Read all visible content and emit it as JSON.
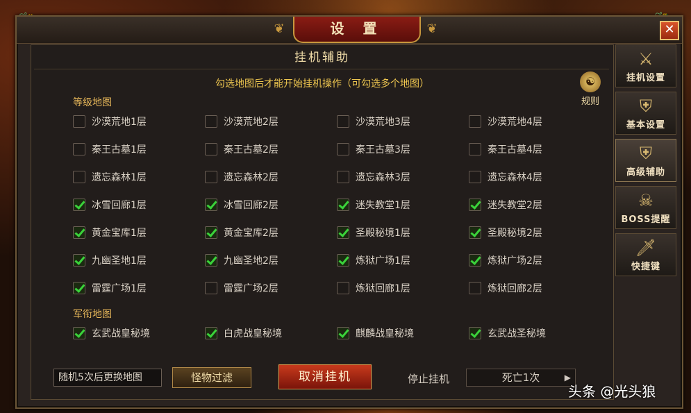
{
  "window": {
    "title": "设 置",
    "close_icon": "✕"
  },
  "panel": {
    "subtitle": "挂机辅助",
    "hint": "勾选地图后才能开始挂机操作（可勾选多个地图）",
    "rules_label": "规则"
  },
  "level_maps": {
    "label": "等级地图",
    "rows": [
      [
        {
          "label": "沙漠荒地1层",
          "checked": false
        },
        {
          "label": "沙漠荒地2层",
          "checked": false
        },
        {
          "label": "沙漠荒地3层",
          "checked": false
        },
        {
          "label": "沙漠荒地4层",
          "checked": false
        }
      ],
      [
        {
          "label": "秦王古墓1层",
          "checked": false
        },
        {
          "label": "秦王古墓2层",
          "checked": false
        },
        {
          "label": "秦王古墓3层",
          "checked": false
        },
        {
          "label": "秦王古墓4层",
          "checked": false
        }
      ],
      [
        {
          "label": "遗忘森林1层",
          "checked": false
        },
        {
          "label": "遗忘森林2层",
          "checked": false
        },
        {
          "label": "遗忘森林3层",
          "checked": false
        },
        {
          "label": "遗忘森林4层",
          "checked": false
        }
      ],
      [
        {
          "label": "冰雪回廊1层",
          "checked": true
        },
        {
          "label": "冰雪回廊2层",
          "checked": true
        },
        {
          "label": "迷失教堂1层",
          "checked": true
        },
        {
          "label": "迷失教堂2层",
          "checked": true
        }
      ],
      [
        {
          "label": "黄金宝库1层",
          "checked": true
        },
        {
          "label": "黄金宝库2层",
          "checked": true
        },
        {
          "label": "圣殿秘境1层",
          "checked": true
        },
        {
          "label": "圣殿秘境2层",
          "checked": true
        }
      ],
      [
        {
          "label": "九幽圣地1层",
          "checked": true
        },
        {
          "label": "九幽圣地2层",
          "checked": true
        },
        {
          "label": "炼狱广场1层",
          "checked": true
        },
        {
          "label": "炼狱广场2层",
          "checked": true
        }
      ],
      [
        {
          "label": "雷霆广场1层",
          "checked": true
        },
        {
          "label": "雷霆广场2层",
          "checked": false
        },
        {
          "label": "炼狱回廊1层",
          "checked": false
        },
        {
          "label": "炼狱回廊2层",
          "checked": false
        }
      ]
    ]
  },
  "rank_maps": {
    "label": "军衔地图",
    "rows": [
      [
        {
          "label": "玄武战皇秘境",
          "checked": true
        },
        {
          "label": "白虎战皇秘境",
          "checked": true
        },
        {
          "label": "麒麟战皇秘境",
          "checked": true
        },
        {
          "label": "玄武战圣秘境",
          "checked": true
        }
      ]
    ]
  },
  "bottom": {
    "switch_select": "随机5次后更换地图",
    "monster_filter": "怪物过滤",
    "cancel_afk": "取消挂机",
    "stop_label": "停止挂机",
    "stop_value": "死亡1次"
  },
  "tabs": [
    {
      "label": "挂机设置",
      "icon": "crossed-swords-icon"
    },
    {
      "label": "基本设置",
      "icon": "shield-emblem-icon"
    },
    {
      "label": "高级辅助",
      "icon": "shield-emblem-icon",
      "active": true
    },
    {
      "label": "BOSS提醒",
      "icon": "demon-skull-icon"
    },
    {
      "label": "快捷键",
      "icon": "sword-emblem-icon"
    }
  ],
  "watermark": "头条 @光头狼"
}
